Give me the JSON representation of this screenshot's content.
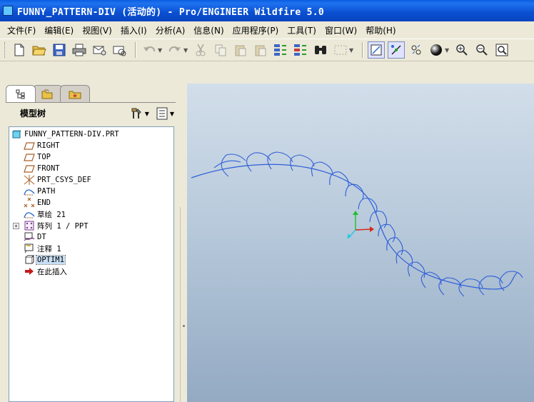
{
  "window": {
    "title": "FUNNY_PATTERN-DIV (活动的) - Pro/ENGINEER Wildfire 5.0"
  },
  "menu": [
    {
      "label": "文件(F)"
    },
    {
      "label": "编辑(E)"
    },
    {
      "label": "视图(V)"
    },
    {
      "label": "插入(I)"
    },
    {
      "label": "分析(A)"
    },
    {
      "label": "信息(N)"
    },
    {
      "label": "应用程序(P)"
    },
    {
      "label": "工具(T)"
    },
    {
      "label": "窗口(W)"
    },
    {
      "label": "帮助(H)"
    }
  ],
  "navigator": {
    "title": "模型树",
    "tree": [
      {
        "label": "FUNNY_PATTERN-DIV.PRT",
        "icon": "part-icon"
      },
      {
        "label": "RIGHT",
        "icon": "datum-plane-icon"
      },
      {
        "label": "TOP",
        "icon": "datum-plane-icon"
      },
      {
        "label": "FRONT",
        "icon": "datum-plane-icon"
      },
      {
        "label": "PRT_CSYS_DEF",
        "icon": "csys-icon"
      },
      {
        "label": "PATH",
        "icon": "sketch-curve-icon"
      },
      {
        "label": "END",
        "icon": "datum-point-icon"
      },
      {
        "label": "草绘 21",
        "icon": "sketch-curve-icon"
      },
      {
        "label": "阵列 1 / PPT",
        "icon": "pattern-icon"
      },
      {
        "label": "DT",
        "icon": "datum-feature-icon"
      },
      {
        "label": "注释 1",
        "icon": "annotation-icon"
      },
      {
        "label": "OPTIM1",
        "icon": "feature-icon"
      },
      {
        "label": "在此插入",
        "icon": "insert-here-arrow-icon"
      }
    ]
  },
  "colors": {
    "titlebar": "#0a4fd1",
    "viewport_top": "#d2deea",
    "viewport_bottom": "#94aac3",
    "curve": "#2f5fd8",
    "selection": "#c8dff5"
  }
}
